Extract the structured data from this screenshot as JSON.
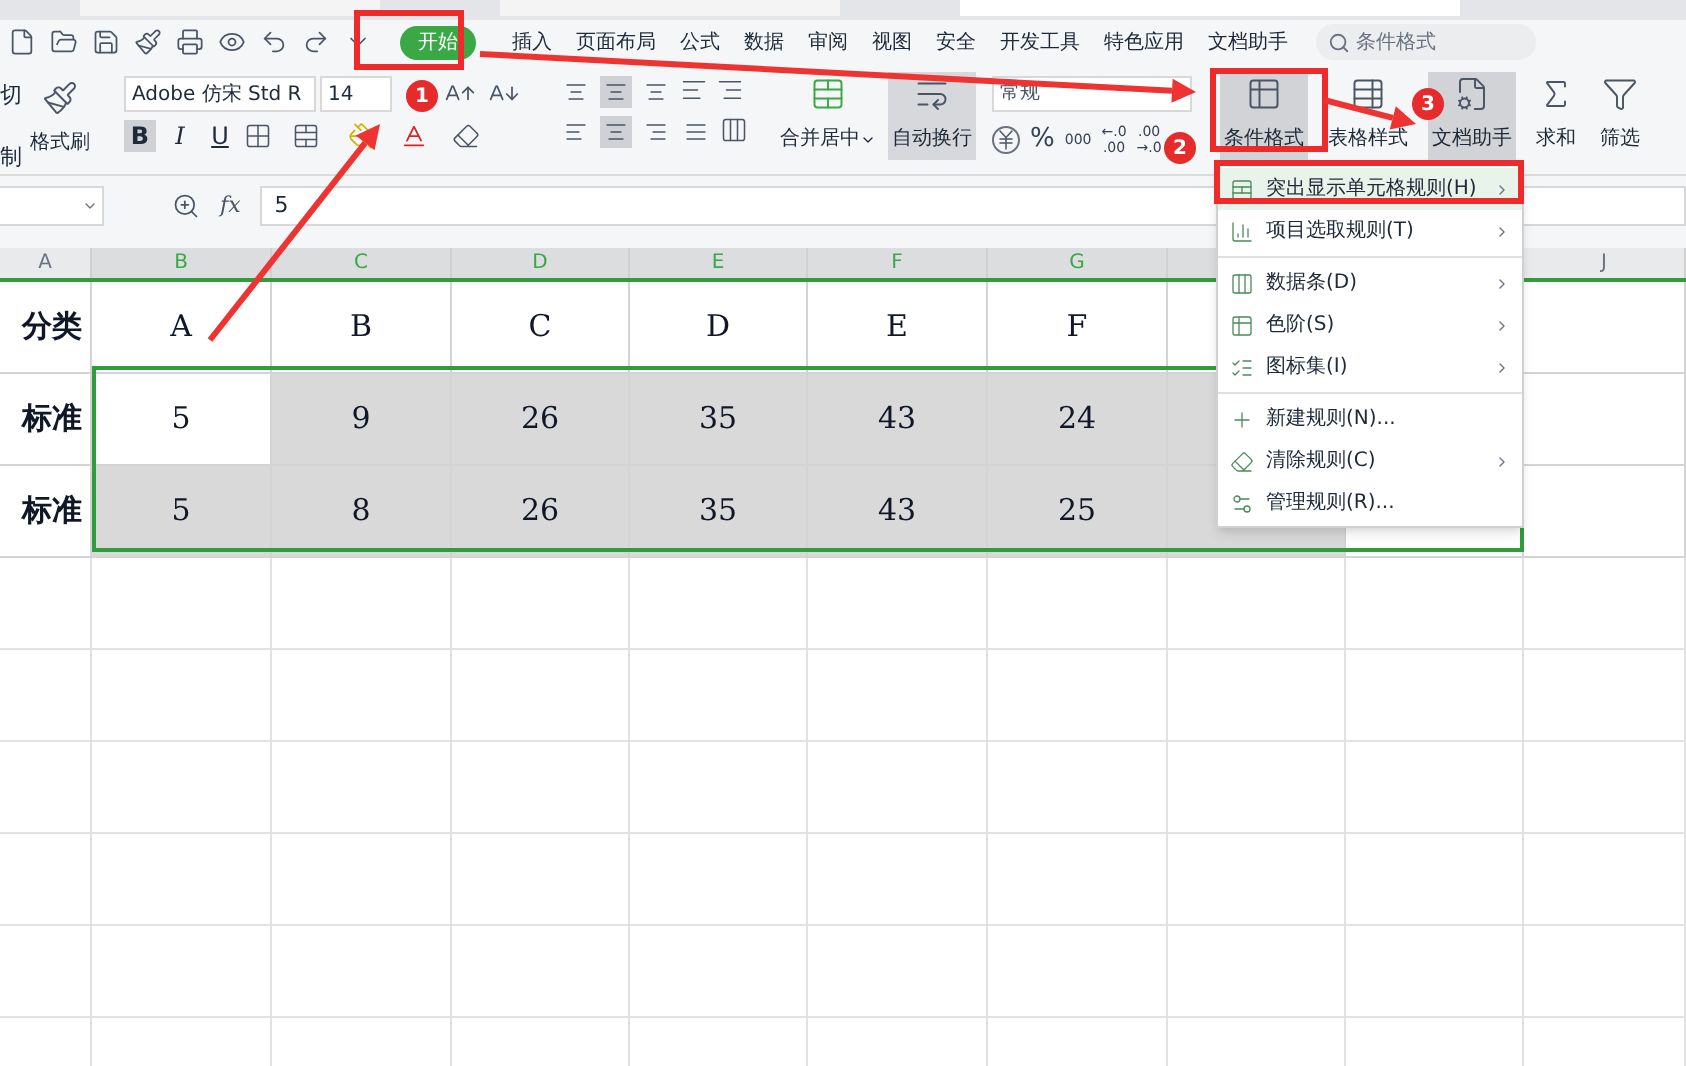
{
  "menu_tabs": [
    {
      "label": "开始",
      "selected": true
    },
    {
      "label": "插入",
      "selected": false
    },
    {
      "label": "页面布局",
      "selected": false
    },
    {
      "label": "公式",
      "selected": false
    },
    {
      "label": "数据",
      "selected": false
    },
    {
      "label": "审阅",
      "selected": false
    },
    {
      "label": "视图",
      "selected": false
    },
    {
      "label": "安全",
      "selected": false
    },
    {
      "label": "开发工具",
      "selected": false
    },
    {
      "label": "特色应用",
      "selected": false
    },
    {
      "label": "文档助手",
      "selected": false
    }
  ],
  "search": {
    "value": "条件格式"
  },
  "clipboard": {
    "cut": "切",
    "copy": "制",
    "format_painter": "格式刷"
  },
  "font": {
    "name": "Adobe 仿宋 Std R",
    "size": "14"
  },
  "font_styles": [
    {
      "label": "B",
      "selected": true
    },
    {
      "label": "I",
      "selected": false
    },
    {
      "label": "U",
      "selected": false
    }
  ],
  "align_top": [
    {
      "selected": false
    },
    {
      "selected": true
    },
    {
      "selected": false
    }
  ],
  "align_bottom": [
    {
      "selected": false
    },
    {
      "selected": true
    },
    {
      "selected": false
    },
    {
      "selected": false
    }
  ],
  "merge": {
    "label": "合并居中"
  },
  "wrap": {
    "label": "自动换行",
    "selected": true
  },
  "number": {
    "format": "常规",
    "buttons": [
      "%",
      "000",
      "←.0\n.00",
      ".00\n→.0"
    ]
  },
  "big_buttons": [
    {
      "label": "条件格式",
      "selected": true
    },
    {
      "label": "表格样式",
      "selected": false
    },
    {
      "label": "文档助手",
      "selected": true
    },
    {
      "label": "求和",
      "selected": false
    },
    {
      "label": "筛选",
      "selected": false
    }
  ],
  "formula_bar": {
    "fx": "fx",
    "value": "5"
  },
  "columns": [
    {
      "label": "A",
      "selected": false
    },
    {
      "label": "B",
      "selected": true
    },
    {
      "label": "C",
      "selected": true
    },
    {
      "label": "D",
      "selected": true
    },
    {
      "label": "E",
      "selected": true
    },
    {
      "label": "F",
      "selected": true
    },
    {
      "label": "G",
      "selected": true
    },
    {
      "label": "J",
      "selected": false
    }
  ],
  "rows": [
    {
      "cells": [
        {
          "text": "分类",
          "highlighted": false
        },
        {
          "text": "A",
          "highlighted": false
        },
        {
          "text": "B",
          "highlighted": false
        },
        {
          "text": "C",
          "highlighted": false
        },
        {
          "text": "D",
          "highlighted": false
        },
        {
          "text": "E",
          "highlighted": false
        },
        {
          "text": "F",
          "highlighted": false
        }
      ]
    },
    {
      "cells": [
        {
          "text": "标准",
          "highlighted": false
        },
        {
          "text": "5",
          "highlighted": false
        },
        {
          "text": "9",
          "highlighted": true
        },
        {
          "text": "26",
          "highlighted": true
        },
        {
          "text": "35",
          "highlighted": true
        },
        {
          "text": "43",
          "highlighted": true
        },
        {
          "text": "24",
          "highlighted": true
        },
        {
          "highlighted": true
        }
      ]
    },
    {
      "cells": [
        {
          "text": "标准",
          "highlighted": false
        },
        {
          "text": "5",
          "highlighted": true
        },
        {
          "text": "8",
          "highlighted": true
        },
        {
          "text": "26",
          "highlighted": true
        },
        {
          "text": "35",
          "highlighted": true
        },
        {
          "text": "43",
          "highlighted": true
        },
        {
          "text": "25",
          "highlighted": true
        },
        {
          "highlighted": true
        }
      ]
    }
  ],
  "dropdown": [
    {
      "label": "突出显示单元格规则(H)",
      "submenu": true,
      "selected": true
    },
    {
      "label": "项目选取规则(T)",
      "submenu": true,
      "selected": false,
      "separator_after": true
    },
    {
      "label": "数据条(D)",
      "submenu": true,
      "selected": false
    },
    {
      "label": "色阶(S)",
      "submenu": true,
      "selected": false
    },
    {
      "label": "图标集(I)",
      "submenu": true,
      "selected": false,
      "separator_after": true
    },
    {
      "label": "新建规则(N)...",
      "submenu": false,
      "selected": false
    },
    {
      "label": "清除规则(C)",
      "submenu": true,
      "selected": false
    },
    {
      "label": "管理规则(R)...",
      "submenu": false,
      "selected": false
    }
  ],
  "annotations": [
    {
      "number": "1"
    },
    {
      "number": "2"
    },
    {
      "number": "3"
    }
  ]
}
